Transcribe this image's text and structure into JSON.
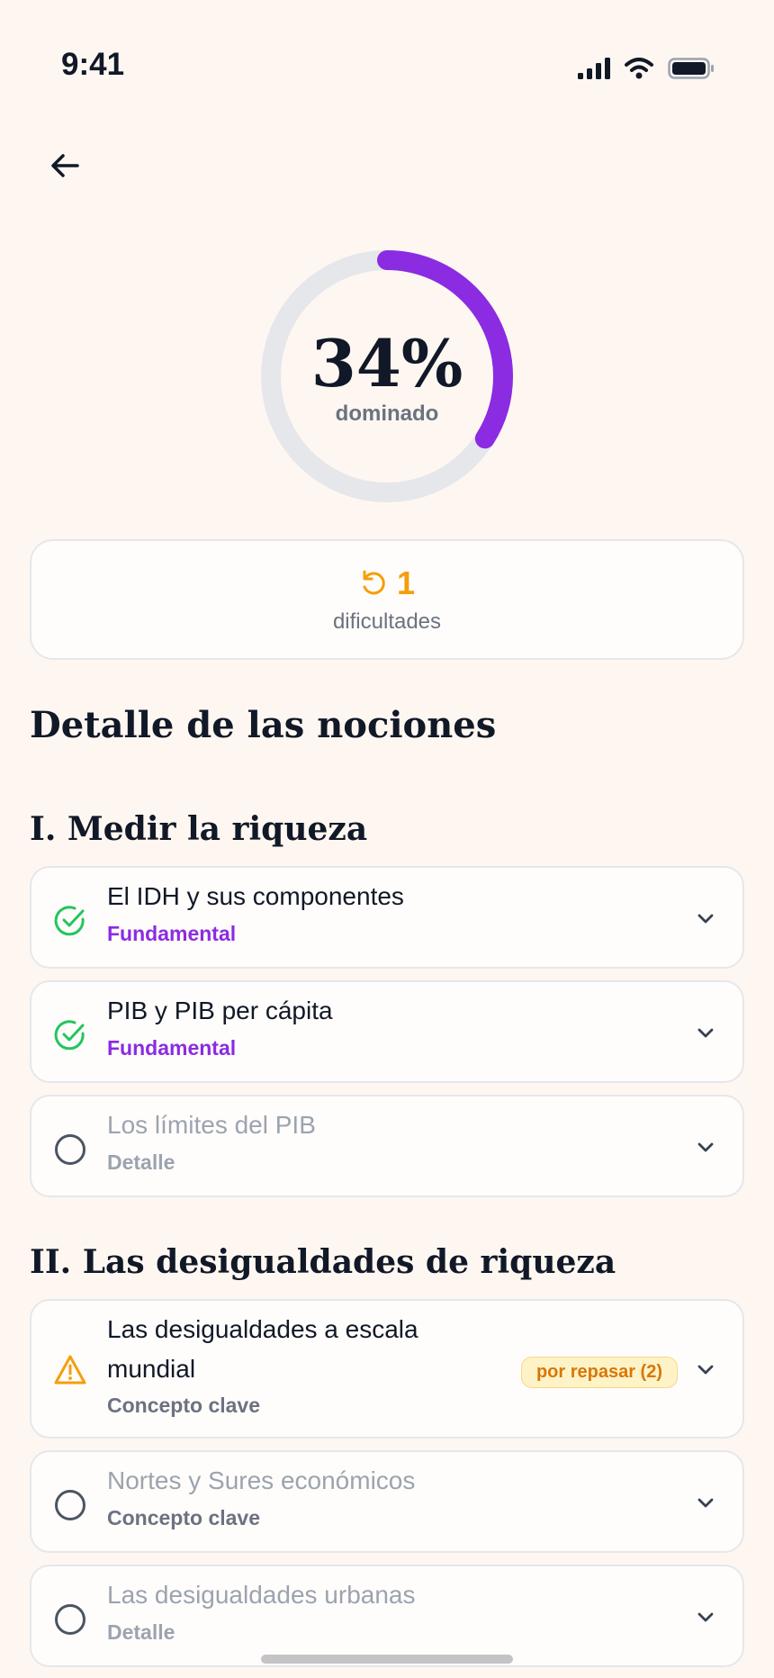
{
  "status": {
    "time": "9:41"
  },
  "progress": {
    "percent_text": "34%",
    "fraction": 0.34,
    "label": "dominado"
  },
  "difficulties": {
    "value": "1",
    "label": "dificultades"
  },
  "detail_heading": "Detalle de las nociones",
  "sections": [
    {
      "title": "I. Medir la riqueza",
      "items": [
        {
          "title": "El IDH y sus componentes",
          "tag": "Fundamental",
          "state": "done"
        },
        {
          "title": "PIB y PIB per cápita",
          "tag": "Fundamental",
          "state": "done"
        },
        {
          "title": "Los límites del PIB",
          "tag": "Detalle",
          "state": "todo"
        }
      ]
    },
    {
      "title": "II. Las desigualdades de riqueza",
      "items": [
        {
          "title_line1": "Las desigualdades a escala",
          "title_line2": "mundial",
          "tag": "Concepto clave",
          "state": "warning",
          "badge": "por repasar (2)"
        },
        {
          "title": "Nortes y Sures económicos",
          "tag": "Concepto clave",
          "state": "todo"
        },
        {
          "title": "Las desigualdades urbanas",
          "tag": "Detalle",
          "state": "todo"
        }
      ]
    }
  ],
  "colors": {
    "accent": "#8b2be2",
    "success": "#22c55e",
    "warning": "#f59e0b",
    "track": "#e5e7eb"
  }
}
